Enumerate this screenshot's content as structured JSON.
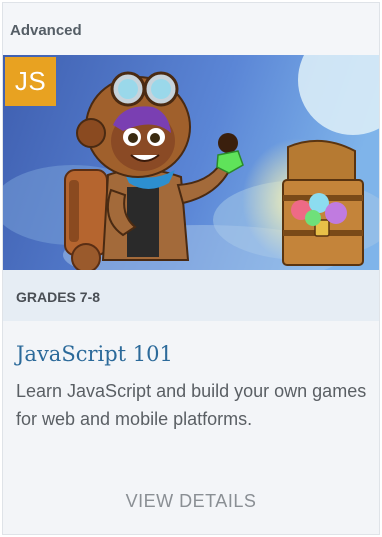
{
  "card": {
    "level_label": "Advanced",
    "language_badge": "JS",
    "hero_image": "explorer-girl-with-jetpack-and-treasure-chest",
    "grades": "GRADES 7-8",
    "title": "JavaScript 101",
    "description": "Learn JavaScript and build your own games for web and mobile platforms.",
    "cta_label": "VIEW DETAILS"
  },
  "colors": {
    "badge": "#e8a221",
    "title": "#2c6a9a",
    "grades_band": "#e6edf4"
  }
}
